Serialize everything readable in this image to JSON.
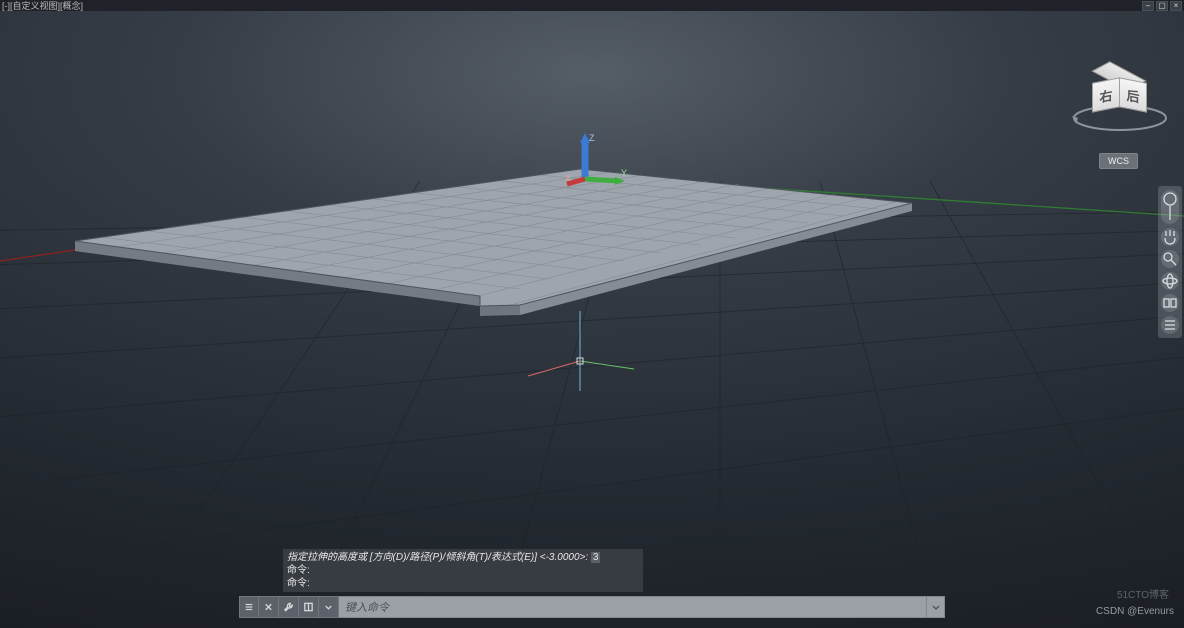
{
  "window": {
    "title": "[-][自定义视图][概念]"
  },
  "viewcube": {
    "front": "右",
    "side": "后"
  },
  "wcs_label": "WCS",
  "ucs_axes": {
    "x": "X",
    "y": "Y",
    "z": "Z"
  },
  "nav_tools": [
    "steering-wheel",
    "pan",
    "zoom",
    "orbit",
    "rewind",
    "options"
  ],
  "command_history": [
    {
      "prefix": "指定拉伸的高度或 [方向(D)/路径(P)/倾斜角(T)/表达式(E)] <-3.0000>:",
      "value": "3"
    },
    {
      "prefix": "命令:",
      "value": ""
    },
    {
      "prefix": "命令:",
      "value": ""
    }
  ],
  "command_input": {
    "placeholder": "键入命令"
  },
  "watermarks": {
    "corner": "51CTO博客",
    "credit": "CSDN @Evenurs"
  }
}
